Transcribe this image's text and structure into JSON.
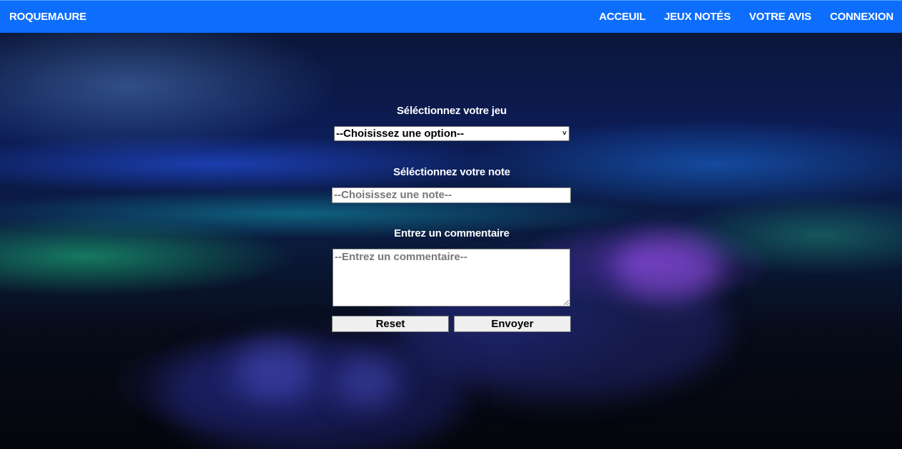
{
  "navbar": {
    "brand": "ROQUEMAURE",
    "links": [
      "ACCEUIL",
      "JEUX NOTÉS",
      "VOTRE AVIS",
      "CONNEXION"
    ],
    "color": "#0d6efd"
  },
  "form": {
    "game_label": "Séléctionnez votre jeu",
    "game_select_value": "--Choisissez une option--",
    "rating_label": "Séléctionnez votre note",
    "rating_placeholder": "--Choisissez une note--",
    "comment_label": "Entrez un commentaire",
    "comment_placeholder": "--Entrez un commentaire--",
    "reset_label": "Reset",
    "submit_label": "Envoyer"
  },
  "icons": {
    "select_arrow": "chevron-down-icon",
    "resize_handle": "resize-grip-icon"
  }
}
